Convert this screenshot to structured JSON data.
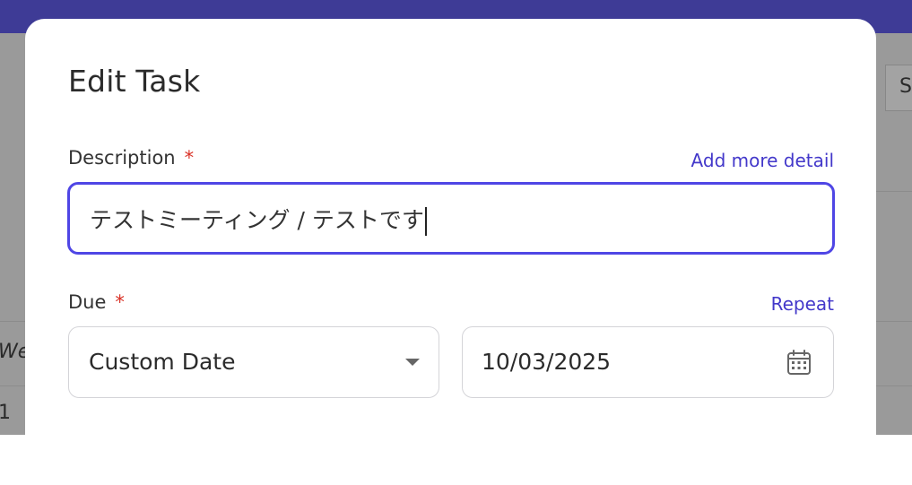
{
  "dialog": {
    "title": "Edit Task"
  },
  "description": {
    "label": "Description",
    "required_mark": "*",
    "link_label": "Add more detail",
    "value": "テストミーティング / テストです"
  },
  "due": {
    "label": "Due",
    "required_mark": "*",
    "link_label": "Repeat",
    "type_value": "Custom Date",
    "date_value": "10/03/2025",
    "date_icon": "calendar-icon",
    "select_icon": "caret-down-icon"
  },
  "background": {
    "cell_text": "S",
    "left_text": "We",
    "left_number": "1"
  },
  "colors": {
    "accent": "#4f46e5",
    "link": "#4338ca",
    "required": "#d93025",
    "top_bar": "#3e3b96",
    "overlay": "#9a9a9a"
  }
}
